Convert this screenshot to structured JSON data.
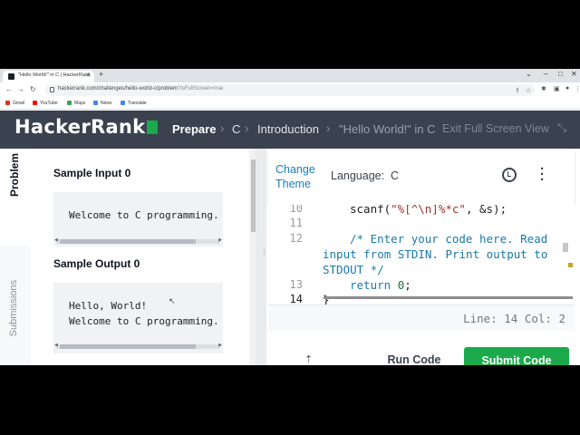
{
  "browser": {
    "tab_title": "\"Hello World!\" in C | HackerRank",
    "new_tab": "+",
    "url_main": "hackerrank.com/challenges/hello-world-c/problem",
    "url_query": "?isFullScreen=true",
    "bookmarks": [
      {
        "label": "Gmail",
        "color": "#d93025"
      },
      {
        "label": "YouTube",
        "color": "#ff0000"
      },
      {
        "label": "Maps",
        "color": "#34a853"
      },
      {
        "label": "News",
        "color": "#4285f4"
      },
      {
        "label": "Translate",
        "color": "#4285f4"
      }
    ]
  },
  "header": {
    "logo": "HackerRank",
    "crumbs": [
      "Prepare",
      "C",
      "Introduction",
      "\"Hello World!\" in C"
    ],
    "exit_fullscreen": "Exit Full Screen View"
  },
  "sidebar": {
    "tab_problem": "Problem",
    "tab_submissions": "Submissions"
  },
  "problem": {
    "sample_input_title": "Sample Input 0",
    "sample_input_lines": [
      "Welcome to C programming."
    ],
    "sample_output_title": "Sample Output 0",
    "sample_output_lines": [
      "Hello, World!",
      "Welcome to C programming."
    ]
  },
  "editor": {
    "change_theme_line1": "Change",
    "change_theme_line2": "Theme",
    "language_label": "Language:",
    "language_value": "C",
    "line_numbers": [
      "10",
      "11",
      "12",
      "",
      "",
      "13",
      "14"
    ],
    "code": {
      "l10_pre": "scanf(",
      "l10_str": "\"%[^\\n]%*c\"",
      "l10_post": ", &s);",
      "l12_a": "/* Enter your code here. Read",
      "l12_b": "input from STDIN. Print output to",
      "l12_c": "STDOUT */",
      "l13_kw": "return",
      "l13_num": "0",
      "l13_end": ";",
      "l14": "}"
    },
    "status": "Line: 14 Col: 2"
  },
  "actions": {
    "run_code": "Run Code",
    "submit_code": "Submit Code"
  },
  "colors": {
    "header_bg": "#39424e",
    "brand_green": "#1ba94c",
    "link_blue": "#1a7fb8"
  }
}
